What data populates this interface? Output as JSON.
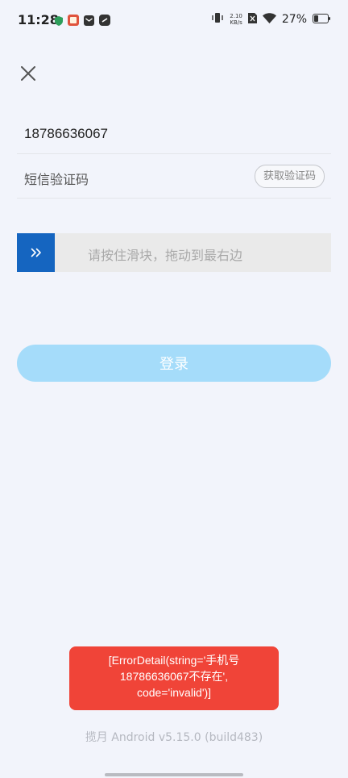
{
  "status_bar": {
    "time": "11:28",
    "net_speed_value": "2.10",
    "net_speed_unit": "KB/s",
    "battery_percent": "27%",
    "left_icons": [
      "shield-icon",
      "app-notification-icon",
      "mail-icon",
      "link-icon"
    ],
    "right_icons": [
      "vibrate-icon",
      "sim-off-icon",
      "wifi-icon",
      "battery-icon"
    ]
  },
  "form": {
    "phone_value": "18786636067",
    "code_placeholder": "短信验证码",
    "get_code_label": "获取验证码",
    "slider_text": "请按住滑块，拖动到最右边",
    "login_label": "登录"
  },
  "toast": {
    "line1": "[ErrorDetail(string='手机号",
    "line2": "18786636067不存在',",
    "line3": "code='invalid')]"
  },
  "footer": {
    "version": "揽月 Android v5.15.0 (build483)"
  },
  "colors": {
    "background": "#f2f4fb",
    "slider_handle": "#1565c0",
    "login_button": "#a5dcfa",
    "toast": "#f04438"
  }
}
